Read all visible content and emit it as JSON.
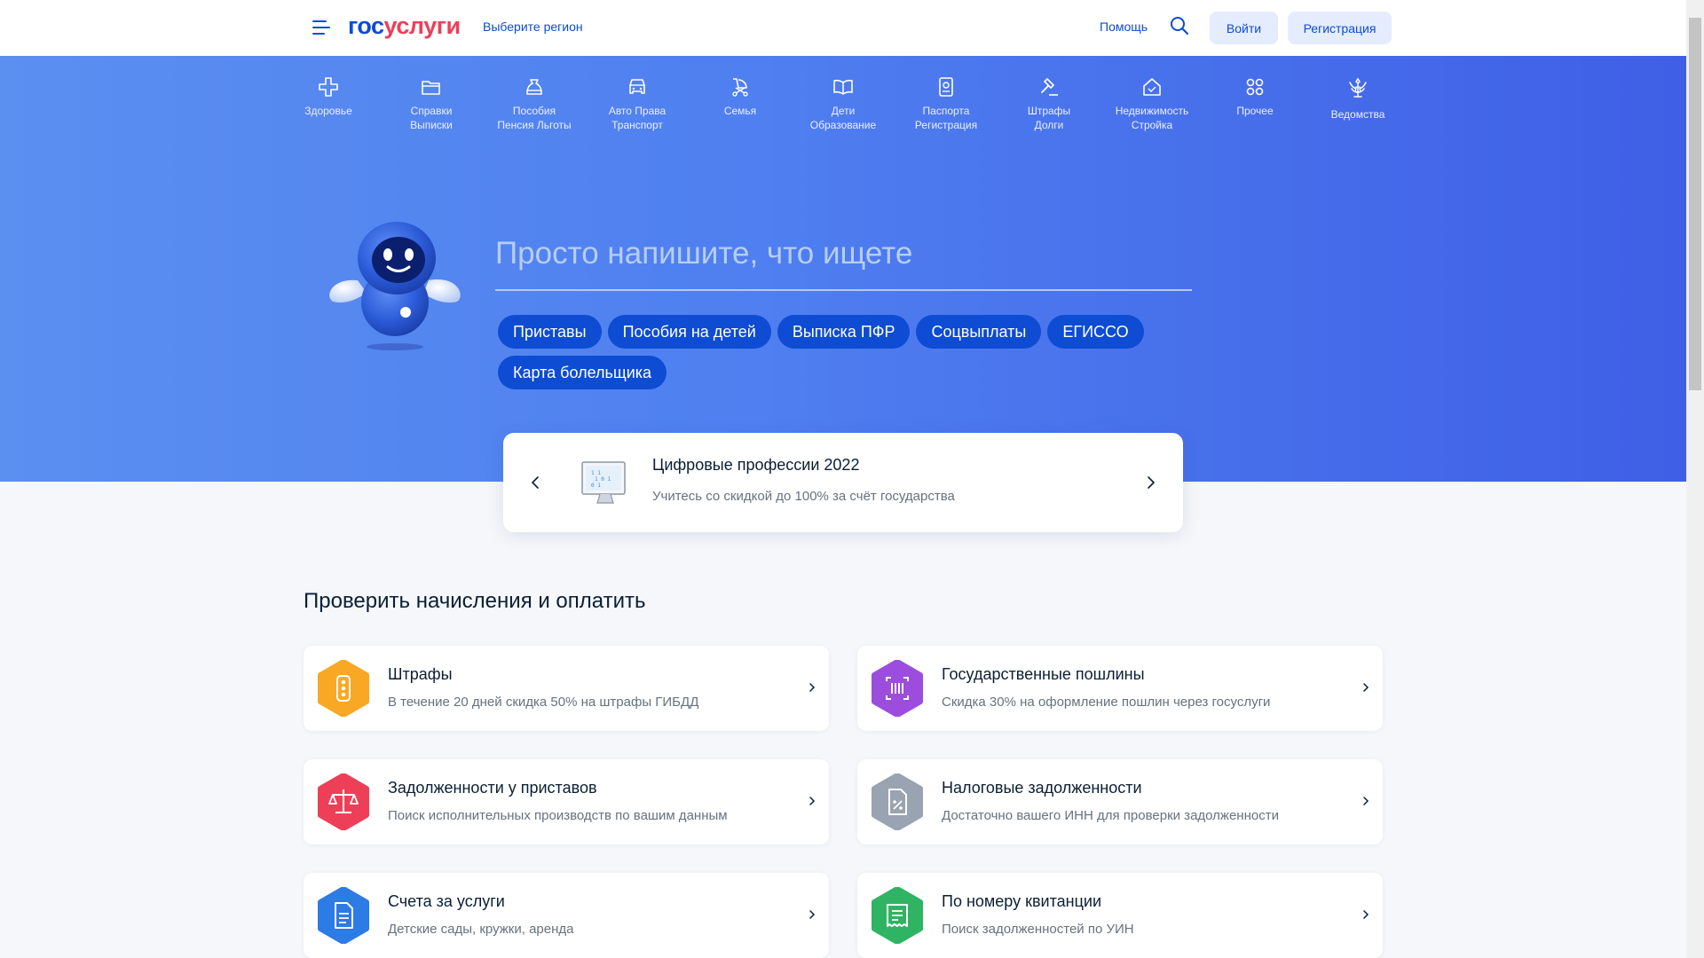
{
  "header": {
    "logo_part1": "гос",
    "logo_part2": "услуги",
    "region": "Выберите регион",
    "help": "Помощь",
    "login": "Войти",
    "register": "Регистрация"
  },
  "categories": [
    {
      "icon": "health-cross-icon",
      "line1": "Здоровье",
      "line2": ""
    },
    {
      "icon": "folder-icon",
      "line1": "Справки",
      "line2": "Выписки"
    },
    {
      "icon": "moneybag-icon",
      "line1": "Пособия",
      "line2": "Пенсия Льготы"
    },
    {
      "icon": "car-icon",
      "line1": "Авто Права",
      "line2": "Транспорт"
    },
    {
      "icon": "stroller-icon",
      "line1": "Семья",
      "line2": ""
    },
    {
      "icon": "book-icon",
      "line1": "Дети",
      "line2": "Образование"
    },
    {
      "icon": "passport-icon",
      "line1": "Паспорта",
      "line2": "Регистрация"
    },
    {
      "icon": "gavel-icon",
      "line1": "Штрафы",
      "line2": "Долги"
    },
    {
      "icon": "house-icon",
      "line1": "Недвижимость",
      "line2": "Стройка"
    },
    {
      "icon": "grid-icon",
      "line1": "Прочее",
      "line2": ""
    },
    {
      "icon": "coat-of-arms-icon",
      "line1": "Ведомства",
      "line2": ""
    }
  ],
  "search": {
    "placeholder": "Просто напишите, что ищете"
  },
  "chips": [
    "Приставы",
    "Пособия на детей",
    "Выписка ПФР",
    "Соцвыплаты",
    "ЕГИССО",
    "Карта болельщика"
  ],
  "promo": {
    "title": "Цифровые профессии 2022",
    "subtitle": "Учитесь со скидкой до 100% за счёт государства"
  },
  "section_title": "Проверить начисления и оплатить",
  "cards": [
    {
      "title": "Штрафы",
      "subtitle": "В течение 20 дней скидка 50% на штрафы ГИБДД",
      "color": "#f9a825",
      "icon": "traffic-light-icon"
    },
    {
      "title": "Государственные пошлины",
      "subtitle": "Скидка 30% на оформление пошлин через госуслуги",
      "color": "#9c4dde",
      "icon": "barcode-icon"
    },
    {
      "title": "Задолженности у приставов",
      "subtitle": "Поиск исполнительных производств по вашим данным",
      "color": "#ee3f58",
      "icon": "scales-icon"
    },
    {
      "title": "Налоговые задолженности",
      "subtitle": "Достаточно вашего ИНН для проверки задолженности",
      "color": "#9aa3b1",
      "icon": "tax-document-icon"
    },
    {
      "title": "Счета за услуги",
      "subtitle": "Детские сады, кружки, аренда",
      "color": "#2d7be5",
      "icon": "invoice-icon"
    },
    {
      "title": "По номеру квитанции",
      "subtitle": "Поиск задолженностей по УИН",
      "color": "#2fb463",
      "icon": "receipt-icon"
    }
  ]
}
